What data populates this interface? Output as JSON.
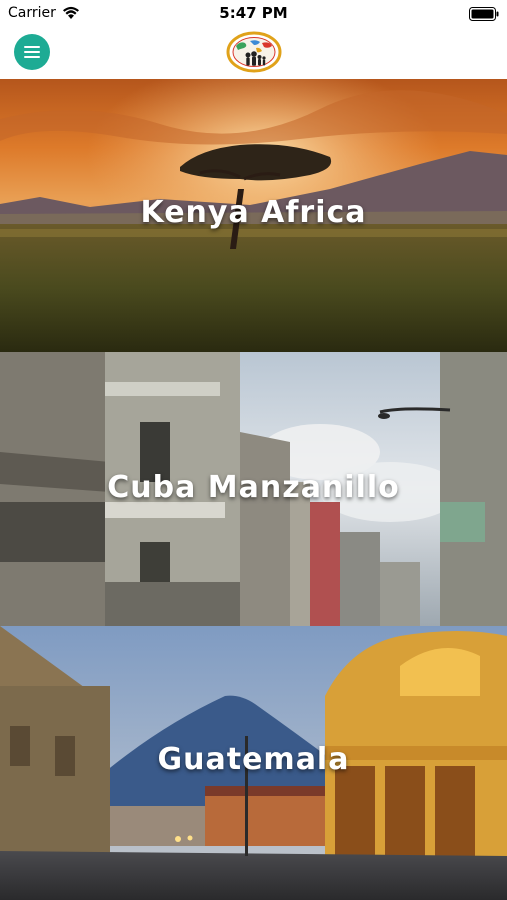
{
  "status_bar": {
    "carrier": "Carrier",
    "time": "5:47 PM"
  },
  "nav": {
    "menu_icon": "hamburger-menu-icon",
    "accent_color": "#1dab94"
  },
  "destinations": [
    {
      "label": "Kenya Africa"
    },
    {
      "label": "Cuba Manzanillo"
    },
    {
      "label": "Guatemala"
    }
  ]
}
